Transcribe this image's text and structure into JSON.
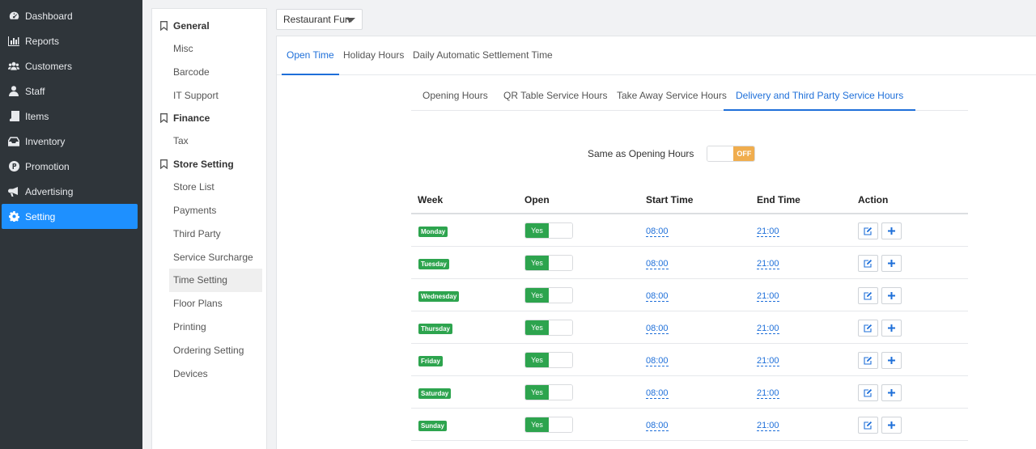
{
  "nav": {
    "items": [
      {
        "label": "Dashboard",
        "icon": "dashboard-icon"
      },
      {
        "label": "Reports",
        "icon": "bar-chart-icon"
      },
      {
        "label": "Customers",
        "icon": "users-icon"
      },
      {
        "label": "Staff",
        "icon": "staff-icon"
      },
      {
        "label": "Items",
        "icon": "book-icon"
      },
      {
        "label": "Inventory",
        "icon": "inbox-icon"
      },
      {
        "label": "Promotion",
        "icon": "promotion-icon"
      },
      {
        "label": "Advertising",
        "icon": "megaphone-icon"
      },
      {
        "label": "Setting",
        "icon": "gear-icon"
      }
    ],
    "active": "Setting"
  },
  "submenu": {
    "groups": [
      {
        "title": "General",
        "items": [
          "Misc",
          "Barcode",
          "IT Support"
        ]
      },
      {
        "title": "Finance",
        "items": [
          "Tax"
        ]
      },
      {
        "title": "Store Setting",
        "items": [
          "Store List",
          "Payments",
          "Third Party",
          "Service Surcharge",
          "Time Setting",
          "Floor Plans",
          "Printing",
          "Ordering Setting",
          "Devices"
        ]
      }
    ],
    "active": "Time Setting"
  },
  "store_select": {
    "value": "Restaurant Fun"
  },
  "top_tabs": [
    "Open Time",
    "Holiday Hours",
    "Daily Automatic Settlement Time"
  ],
  "top_tab_active": "Open Time",
  "sub_tabs": [
    "Opening Hours",
    "QR Table Service Hours",
    "Take Away Service Hours",
    "Delivery and Third Party Service Hours"
  ],
  "sub_tab_active": "Delivery and Third Party Service Hours",
  "same_as": {
    "label": "Same as Opening Hours",
    "state": "OFF"
  },
  "table": {
    "headers": {
      "week": "Week",
      "open": "Open",
      "start": "Start Time",
      "end": "End Time",
      "action": "Action"
    },
    "rows": [
      {
        "day": "Monday",
        "open": "Yes",
        "start": "08:00",
        "end": "21:00"
      },
      {
        "day": "Tuesday",
        "open": "Yes",
        "start": "08:00",
        "end": "21:00"
      },
      {
        "day": "Wednesday",
        "open": "Yes",
        "start": "08:00",
        "end": "21:00"
      },
      {
        "day": "Thursday",
        "open": "Yes",
        "start": "08:00",
        "end": "21:00"
      },
      {
        "day": "Friday",
        "open": "Yes",
        "start": "08:00",
        "end": "21:00"
      },
      {
        "day": "Saturday",
        "open": "Yes",
        "start": "08:00",
        "end": "21:00"
      },
      {
        "day": "Sunday",
        "open": "Yes",
        "start": "08:00",
        "end": "21:00"
      }
    ]
  },
  "colors": {
    "accent": "#1e6fd9",
    "nav_bg": "#2f353a",
    "nav_active": "#1e90ff",
    "badge_green": "#2da44e",
    "off_orange": "#f0ad4e"
  }
}
